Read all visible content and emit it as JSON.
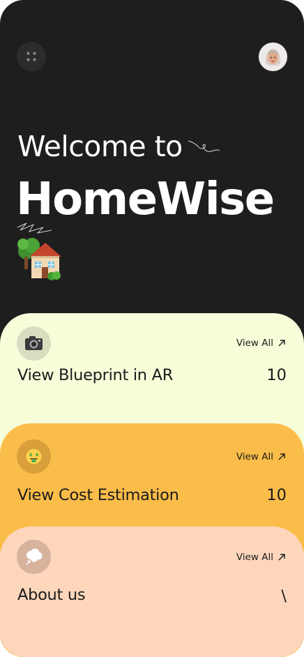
{
  "header": {
    "menu_icon": "grid-dots-icon",
    "avatar_icon": "user-avatar"
  },
  "hero": {
    "welcome": "Welcome to",
    "brand": "HomeWise",
    "emoji": "house-with-garden-icon"
  },
  "cards": [
    {
      "icon": "camera-icon",
      "view_all": "View All",
      "title": "View Blueprint in AR",
      "count": "10",
      "color": "#f6fdd9"
    },
    {
      "icon": "money-mouth-face-icon",
      "view_all": "View All",
      "title": "View Cost Estimation",
      "count": "10",
      "color": "#fbbd49"
    },
    {
      "icon": "thought-balloon-icon",
      "view_all": "View All",
      "title": "About us",
      "count": "\\",
      "color": "#fdd6bc"
    }
  ],
  "colors": {
    "background": "#1e1e1e",
    "text_light": "#ffffff",
    "text_dark": "#1b1b1b"
  }
}
